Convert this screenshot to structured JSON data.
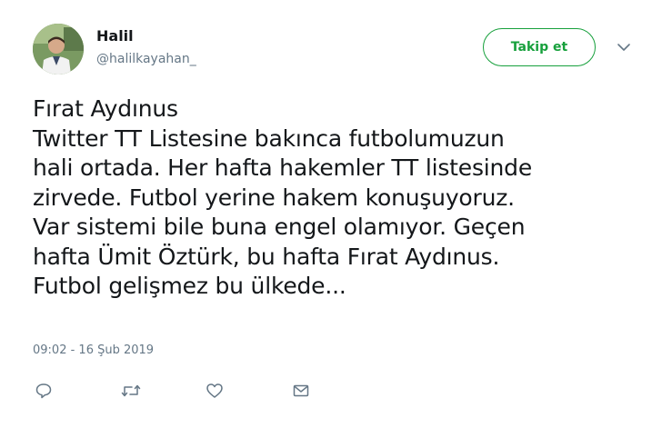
{
  "user": {
    "display_name": "Halil",
    "handle": "@halilkayahan_"
  },
  "follow_button": {
    "label": "Takip et"
  },
  "tweet": {
    "lines": [
      "Fırat Aydınus",
      "Twitter TT Listesine bakınca futbolumuzun",
      "hali ortada. Her hafta hakemler TT listesinde",
      "zirvede. Futbol yerine hakem konuşuyoruz.",
      "Var sistemi bile buna engel olamıyor. Geçen",
      "hafta Ümit Öztürk, bu hafta Fırat Aydınus.",
      "Futbol gelişmez bu ülkede..."
    ],
    "timestamp": "09:02 - 16 Şub 2019"
  },
  "icons": {
    "more": "chevron-down-icon",
    "reply": "reply-icon",
    "retweet": "retweet-icon",
    "like": "heart-icon",
    "message": "envelope-icon"
  },
  "colors": {
    "accent": "#17a03c",
    "text": "#14171a",
    "muted": "#657786"
  }
}
